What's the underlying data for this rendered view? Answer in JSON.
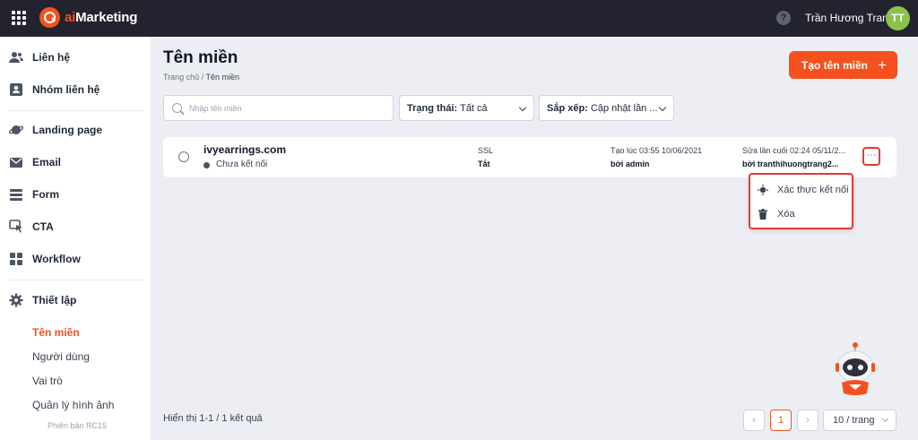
{
  "app": {
    "logo_prefix": "ai",
    "logo_suffix": "Marketing",
    "brand_color": "#f4511e",
    "help_icon": "question-circle-icon"
  },
  "user": {
    "name": "Trần Hương Trang",
    "initials": "TT",
    "avatar_color": "#8bc34a"
  },
  "sidebar": {
    "items": [
      {
        "label": "Liên hệ",
        "icon": "contacts-icon"
      },
      {
        "label": "Nhóm liên hệ",
        "icon": "contact-group-icon"
      },
      {
        "label": "Landing page",
        "icon": "planet-icon"
      },
      {
        "label": "Email",
        "icon": "mail-icon"
      },
      {
        "label": "Form",
        "icon": "form-icon"
      },
      {
        "label": "CTA",
        "icon": "cursor-click-icon"
      },
      {
        "label": "Workflow",
        "icon": "workflow-icon"
      },
      {
        "label": "Thiết lập",
        "icon": "gear-icon"
      }
    ],
    "subitems": [
      {
        "label": "Tên miền",
        "active": true
      },
      {
        "label": "Người dùng",
        "active": false
      },
      {
        "label": "Vai trò",
        "active": false
      },
      {
        "label": "Quản lý hình ảnh",
        "active": false
      }
    ],
    "version": "Phiên bản RC15"
  },
  "page": {
    "title": "Tên miền",
    "breadcrumb_home": "Trang chủ /",
    "breadcrumb_current": "Tên miền",
    "create_button": "Tạo tên miền",
    "create_button_icon": "+"
  },
  "filters": {
    "search_placeholder": "Nhập tên miền",
    "search_value": "",
    "status_label": "Trạng thái:",
    "status_value": "Tất cả",
    "sort_label": "Sắp xếp:",
    "sort_value": "Cập nhật lần ..."
  },
  "rows": [
    {
      "domain": "ivyearrings.com",
      "status": "Chưa kết nối",
      "ssl_label": "SSL",
      "ssl_value": "Tắt",
      "created_label": "Tạo lúc 03:55 10/06/2021",
      "created_by": "bởi admin",
      "updated_label": "Sửa lần cuối 02:24 05/11/2...",
      "updated_by": "bởi tranthihuongtrang2...",
      "more_glyph": "···"
    }
  ],
  "dropdown": {
    "items": [
      {
        "label": "Xác thực kết nối",
        "icon": "verify-connection-icon"
      },
      {
        "label": "Xóa",
        "icon": "trash-icon"
      }
    ]
  },
  "pagination": {
    "summary": "Hiển thị 1-1 / 1 kết quả",
    "prev_glyph": "‹",
    "current_page": "1",
    "next_glyph": "›",
    "page_size": "10 / trang"
  }
}
